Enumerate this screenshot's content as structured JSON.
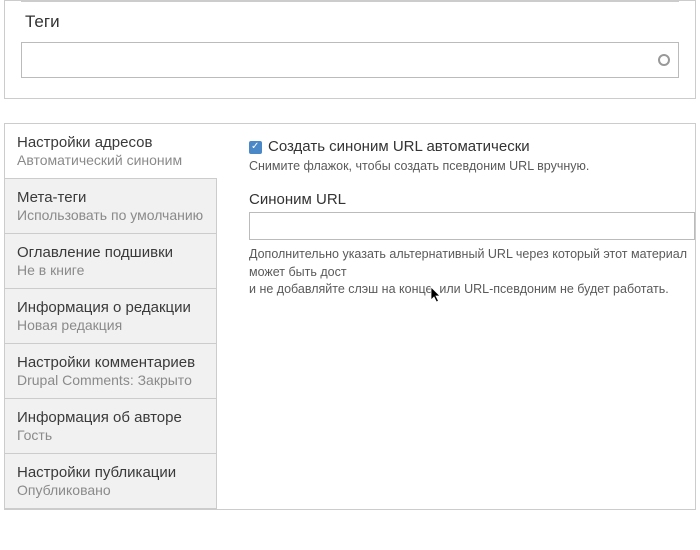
{
  "top": {
    "tags_label": "Теги"
  },
  "tabs": [
    {
      "title": "Настройки адресов",
      "sub": "Автоматический синоним"
    },
    {
      "title": "Мета-теги",
      "sub": "Использовать по умолчанию"
    },
    {
      "title": "Оглавление подшивки",
      "sub": "Не в книге"
    },
    {
      "title": "Информация о редакции",
      "sub": "Новая редакция"
    },
    {
      "title": "Настройки комментариев",
      "sub": "Drupal Comments: Закрыто"
    },
    {
      "title": "Информация об авторе",
      "sub": "Гость"
    },
    {
      "title": "Настройки публикации",
      "sub": "Опубликовано"
    }
  ],
  "url_settings": {
    "auto_checkbox_label": "Создать синоним URL автоматически",
    "auto_hint": "Снимите флажок, чтобы создать псевдоним URL вручную.",
    "alias_label": "Синоним URL",
    "alias_value": "",
    "alias_desc_line1": "Дополнительно указать альтернативный URL через который этот материал может быть дост",
    "alias_desc_line2": "и не добавляйте слэш на конце, или URL-псевдоним не будет работать."
  }
}
